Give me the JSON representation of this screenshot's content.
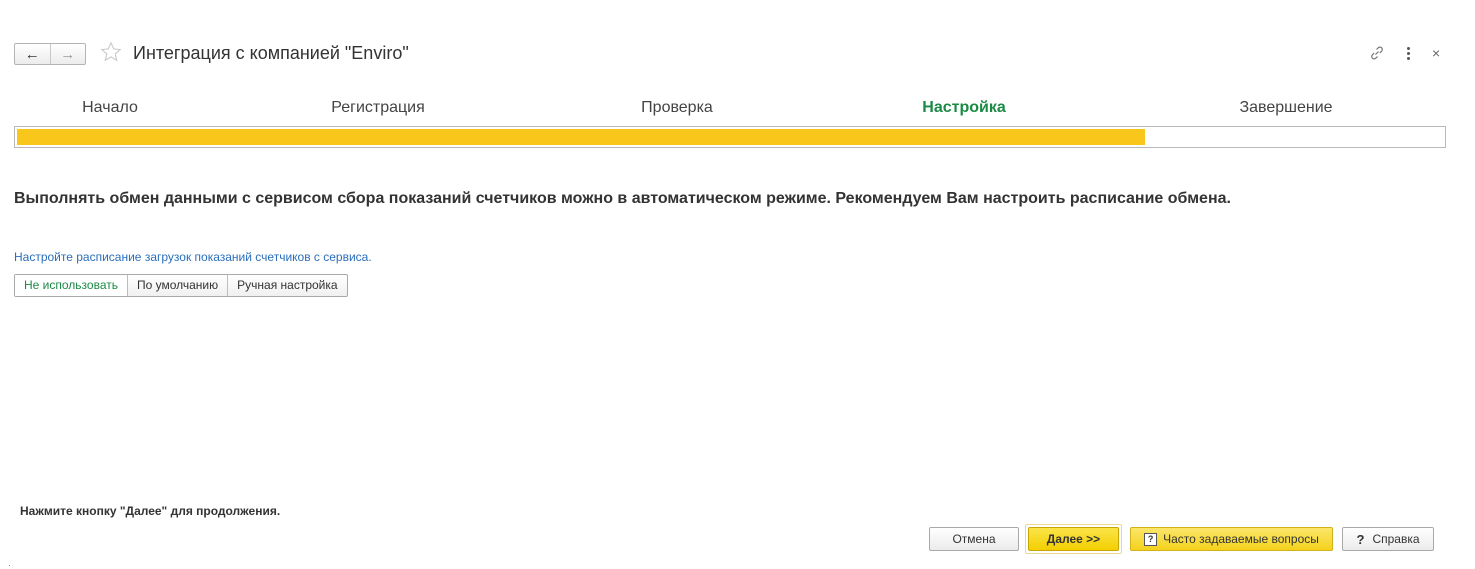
{
  "window": {
    "title": "Интеграция с компанией \"Enviro\"",
    "back_icon": "arrow-left-icon",
    "forward_icon": "arrow-right-icon",
    "favorite_icon": "star-icon",
    "link_icon": "link-icon",
    "more_icon": "more-vertical-icon",
    "close_glyph": "×"
  },
  "steps": [
    {
      "label": "Начало",
      "active": false
    },
    {
      "label": "Регистрация",
      "active": false
    },
    {
      "label": "Проверка",
      "active": false
    },
    {
      "label": "Настройка",
      "active": true
    },
    {
      "label": "Завершение",
      "active": false
    }
  ],
  "progress": {
    "fraction": 0.79,
    "fill_color": "#F9C71B"
  },
  "content": {
    "headline": "Выполнять обмен данными с сервисом сбора показаний счетчиков можно в автоматическом режиме. Рекомендуем Вам настроить расписание обмена.",
    "hint": "Настройте расписание загрузок показаний счетчиков с сервиса.",
    "schedule_options": [
      {
        "label": "Не использовать",
        "selected": true
      },
      {
        "label": "По умолчанию",
        "selected": false
      },
      {
        "label": "Ручная настройка",
        "selected": false
      }
    ]
  },
  "footer": {
    "note": "Нажмите кнопку \"Далее\" для продолжения.",
    "cancel_label": "Отмена",
    "next_label": "Далее >>",
    "faq_label": "Часто задаваемые вопросы",
    "faq_icon": "?",
    "help_label": "Справка",
    "help_icon": "?"
  },
  "colors": {
    "active_step": "#1A8A45",
    "link": "#2A6EBB",
    "accent_yellow": "#F3CF00"
  }
}
